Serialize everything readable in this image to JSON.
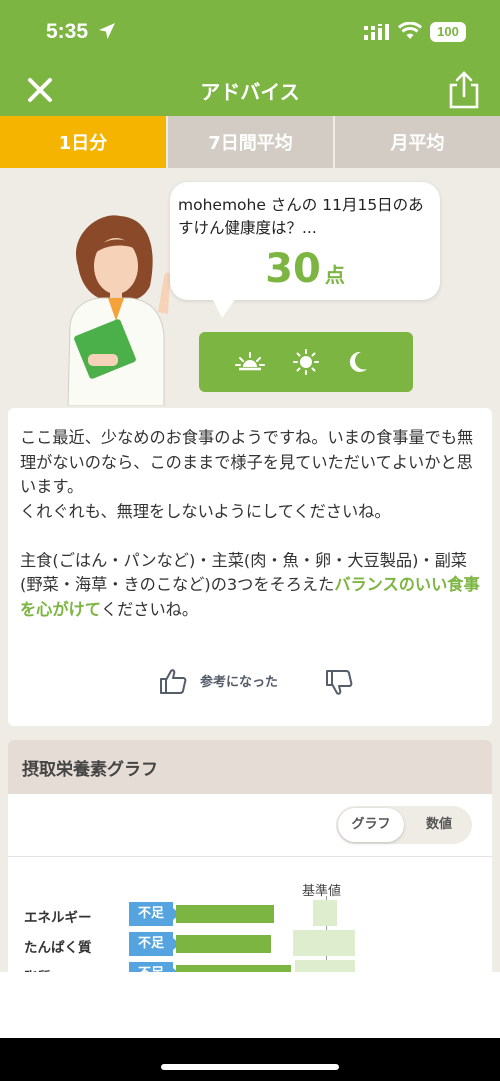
{
  "status": {
    "time": "5:35",
    "battery": "100"
  },
  "nav": {
    "title": "アドバイス"
  },
  "tabs": [
    "1日分",
    "7日間平均",
    "月平均"
  ],
  "bubble": {
    "question": "mohemohe さんの 11月15日のあすけん健康度は？...",
    "score": "30",
    "unit": "点"
  },
  "advice": {
    "p1": "ここ最近、少なめのお食事のようですね。いまの食事量でも無理がないのなら、このままで様子を見ていただいてよいかと思います。",
    "p1b": "くれぐれも、無理をしないようにしてくださいね。",
    "p2_pre": "主食(ごはん・パンなど)・主菜(肉・魚・卵・大豆製品)・副菜(野菜・海草・きのこなど)の3つをそろえた",
    "p2_hl": "バランスのいい食事を心がけて",
    "p2_post": "くださいね。"
  },
  "feedback": {
    "label": "参考になった"
  },
  "graph": {
    "header": "摂取栄養素グラフ",
    "toggle": [
      "グラフ",
      "数値"
    ],
    "ref_label": "基準値",
    "rows": [
      {
        "name": "エネルギー",
        "badge": "不足"
      },
      {
        "name": "たんぱく質",
        "badge": "不足"
      },
      {
        "name": "脂質",
        "badge": "不足"
      }
    ]
  },
  "colors": {
    "brand": "#7db542",
    "tab_active": "#f5b400",
    "badge": "#56a4df"
  },
  "icons": [
    "close-icon",
    "share-icon",
    "sunrise-icon",
    "sun-icon",
    "moon-icon",
    "thumbs-up-icon",
    "thumbs-down-icon",
    "location-arrow-icon",
    "wifi-icon",
    "signal-icon"
  ]
}
